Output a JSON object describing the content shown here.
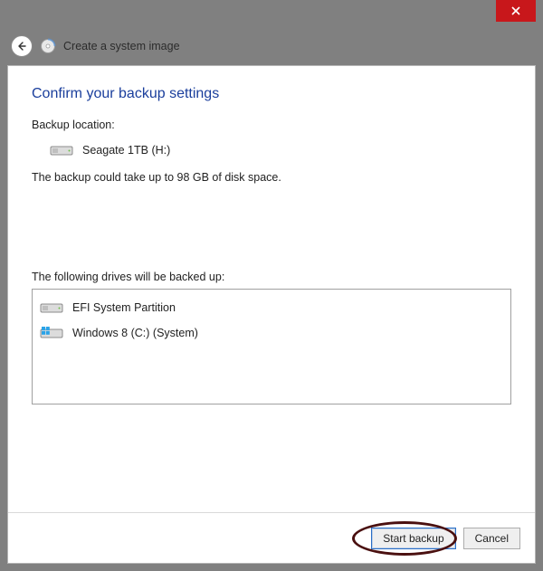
{
  "window": {
    "title": "Create a system image"
  },
  "page": {
    "heading": "Confirm your backup settings",
    "backup_location_label": "Backup location:",
    "backup_location_drive": "Seagate 1TB (H:)",
    "estimate_text": "The backup could take up to 98 GB of disk space.",
    "following_label": "The following drives will be backed up:"
  },
  "drives": [
    {
      "label": "EFI System Partition",
      "icon": "hdd"
    },
    {
      "label": "Windows 8 (C:) (System)",
      "icon": "win"
    }
  ],
  "buttons": {
    "start_backup": "Start backup",
    "cancel": "Cancel"
  }
}
